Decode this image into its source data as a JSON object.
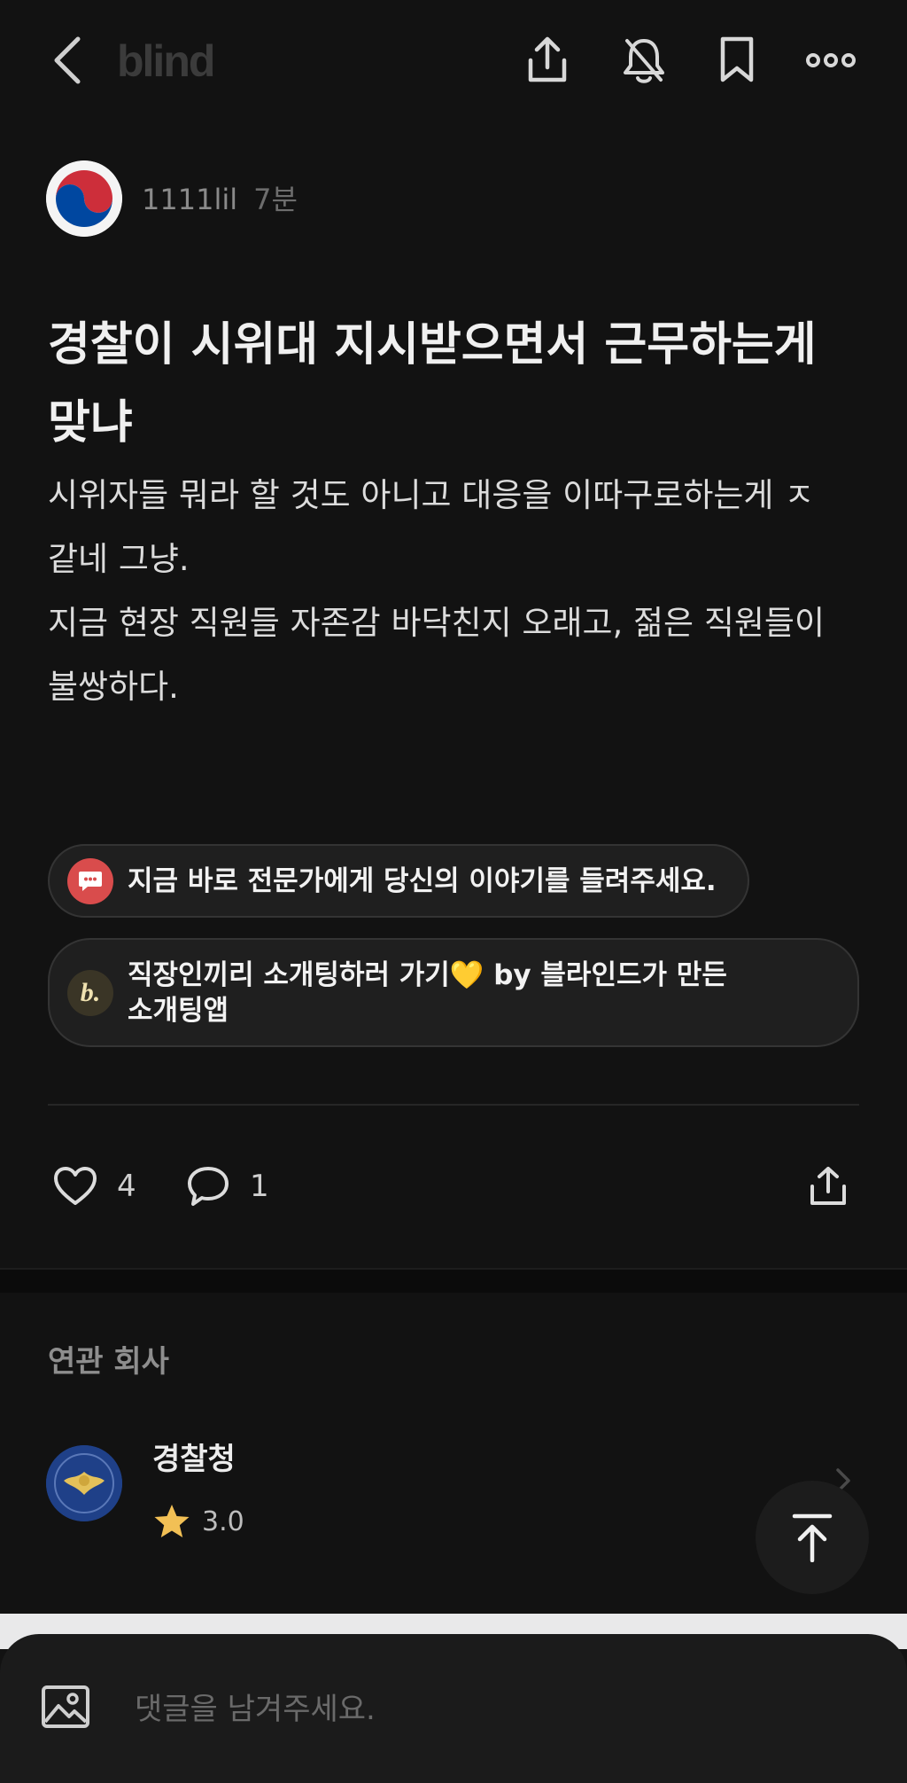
{
  "header": {
    "logo_text": "blind",
    "icons": [
      "back-icon",
      "share-icon",
      "notification-off-icon",
      "bookmark-icon",
      "more-icon"
    ]
  },
  "post": {
    "author": "1111lil",
    "time": "7분",
    "title": "경찰이 시위대 지시받으면서 근무하는게 맞냐",
    "body": "시위자들 뭐라 할 것도 아니고 대응을 이따구로하는게 ㅈ\n같네 그냥.\n지금 현장 직원들 자존감 바닥친지 오래고, 젊은 직원들이\n불쌍하다."
  },
  "banners": [
    {
      "icon": "chat-bubble-icon",
      "text": "지금 바로 전문가에게 당신의 이야기를 들려주세요."
    },
    {
      "icon": "b-logo-icon",
      "icon_text": "b.",
      "text": "직장인끼리 소개팅하러 가기💛 by 블라인드가 만든\n소개팅앱"
    }
  ],
  "actions": {
    "likes": "4",
    "comments": "1"
  },
  "related": {
    "title": "연관 회사",
    "company": {
      "name": "경찰청",
      "rating": "3.0"
    }
  },
  "comment_bar": {
    "placeholder": "댓글을 남겨주세요."
  },
  "colors": {
    "background": "#121212",
    "accent_star": "#f2c055",
    "notice_red": "#d94c4c"
  }
}
